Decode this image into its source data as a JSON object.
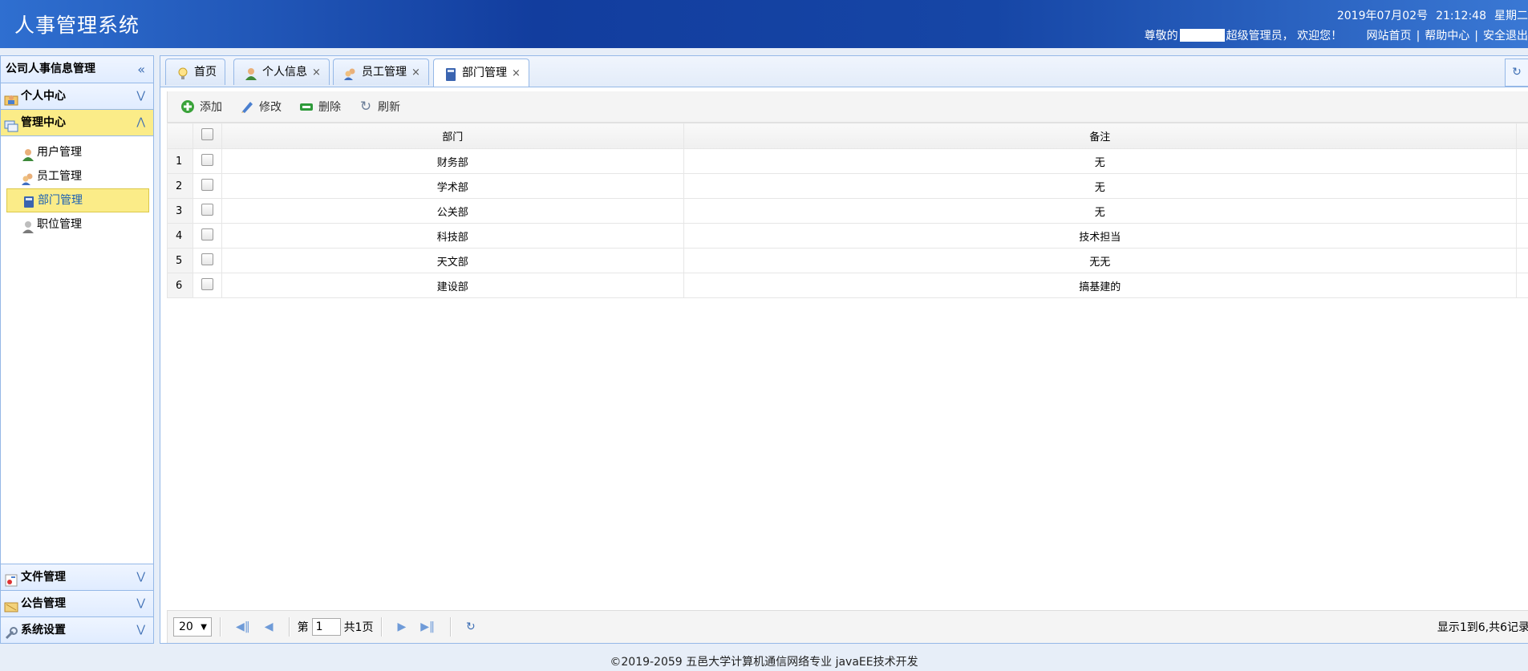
{
  "header": {
    "title": "人事管理系统",
    "date": "2019年07月02号",
    "time": "21:12:48",
    "weekday": "星期二",
    "greeting_prefix": "尊敬的",
    "role_text": "超级管理员，",
    "welcome": "欢迎您！",
    "links": [
      "网站首页",
      "帮助中心",
      "安全退出"
    ],
    "separator": "|"
  },
  "sidebar": {
    "title": "公司人事信息管理",
    "collapse_icon": "double-chevron-left-icon",
    "sections": [
      {
        "label": "个人中心",
        "icon": "person-folder-icon",
        "expanded": false
      },
      {
        "label": "管理中心",
        "icon": "windows-icon",
        "expanded": true,
        "items": [
          {
            "label": "用户管理",
            "icon": "user-icon"
          },
          {
            "label": "员工管理",
            "icon": "users-icon"
          },
          {
            "label": "部门管理",
            "icon": "book-icon",
            "selected": true
          },
          {
            "label": "职位管理",
            "icon": "user-badge-icon"
          }
        ]
      },
      {
        "label": "文件管理",
        "icon": "file-icon",
        "expanded": false
      },
      {
        "label": "公告管理",
        "icon": "announcement-icon",
        "expanded": false
      },
      {
        "label": "系统设置",
        "icon": "wrench-icon",
        "expanded": false
      }
    ]
  },
  "tabs": [
    {
      "label": "首页",
      "icon": "lightbulb-icon",
      "closable": false
    },
    {
      "label": "个人信息",
      "icon": "user-icon",
      "closable": true
    },
    {
      "label": "员工管理",
      "icon": "users-icon",
      "closable": true
    },
    {
      "label": "部门管理",
      "icon": "book-icon",
      "closable": true,
      "active": true
    }
  ],
  "tab_close_glyph": "×",
  "toolbar": {
    "add": "添加",
    "edit": "修改",
    "delete": "删除",
    "refresh": "刷新"
  },
  "table": {
    "columns": [
      "部门",
      "备注"
    ],
    "rows": [
      {
        "num": "1",
        "dept": "财务部",
        "note": "无"
      },
      {
        "num": "2",
        "dept": "学术部",
        "note": "无"
      },
      {
        "num": "3",
        "dept": "公关部",
        "note": "无"
      },
      {
        "num": "4",
        "dept": "科技部",
        "note": "技术担当"
      },
      {
        "num": "5",
        "dept": "天文部",
        "note": "无无"
      },
      {
        "num": "6",
        "dept": "建设部",
        "note": "搞基建的"
      }
    ]
  },
  "pager": {
    "page_size": "20",
    "page_prefix": "第",
    "page_value": "1",
    "page_suffix": "共1页",
    "info": "显示1到6,共6记录"
  },
  "footer": "©2019-2059 五邑大学计算机通信网络专业   javaEE技术开发",
  "colors": {
    "header_bg": "#1646a6",
    "active_bg": "#fbec88",
    "border": "#95b8e7"
  }
}
